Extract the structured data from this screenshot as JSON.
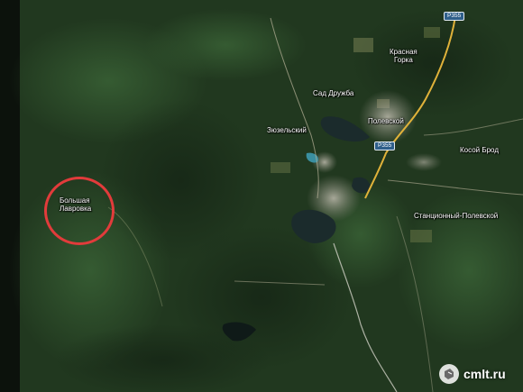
{
  "map": {
    "labels": {
      "krasnaya_gorka": "Красная\nГорка",
      "sad_druzhba": "Сад Дружба",
      "polevskoy": "Полевской",
      "zyuzelsky": "Зюзельский",
      "kossi_brod": "Косой Брод",
      "stantsionny": "Станционный-Полевской",
      "bolshaya_lavrovka": "Большая\nЛавровка"
    },
    "road_shields": {
      "north": "Р355",
      "center": "Р355"
    },
    "highlight": {
      "color": "#e23b3b",
      "target": "bolshaya_lavrovka"
    },
    "colors": {
      "forest": "#1e3320",
      "water": "#1c2a2c",
      "urban": "#9a9a8e",
      "road": "#e0b23a"
    }
  },
  "watermark": {
    "text": "cmlt.ru",
    "icon": "cmlt-logo-icon"
  }
}
